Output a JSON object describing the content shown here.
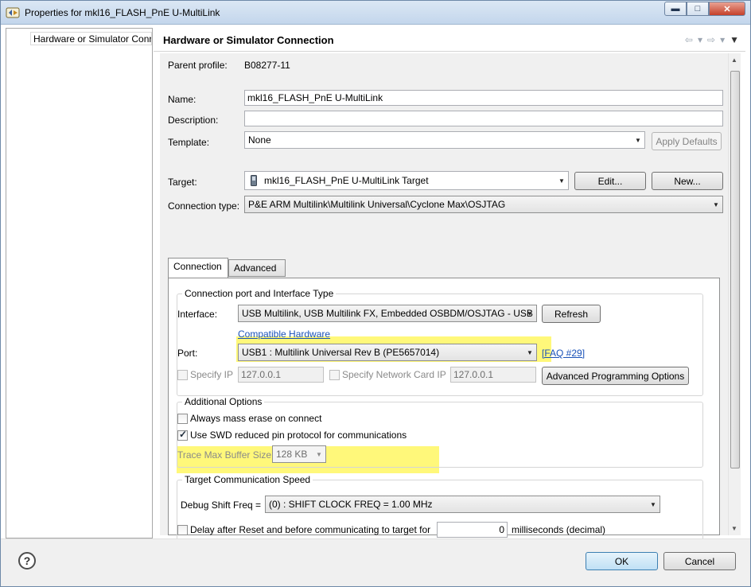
{
  "window": {
    "title": "Properties for mkl16_FLASH_PnE U-MultiLink",
    "minimize": "▬",
    "maximize": "□",
    "close": "✕"
  },
  "sidebar": {
    "items": [
      {
        "label": "Hardware or Simulator Conr"
      }
    ]
  },
  "header": {
    "title": "Hardware or Simulator Connection"
  },
  "form": {
    "parent_profile_label": "Parent profile:",
    "parent_profile_value": "B08277-11",
    "name_label": "Name:",
    "name_value": "mkl16_FLASH_PnE U-MultiLink",
    "description_label": "Description:",
    "description_value": "",
    "template_label": "Template:",
    "template_value": "None",
    "apply_defaults": "Apply Defaults",
    "target_label": "Target:",
    "target_value": "mkl16_FLASH_PnE U-MultiLink Target",
    "edit_button": "Edit...",
    "new_button": "New...",
    "connection_type_label": "Connection type:",
    "connection_type_value": "P&E ARM Multilink\\Multilink Universal\\Cyclone Max\\OSJTAG"
  },
  "tabs": [
    {
      "label": "Connection",
      "active": true
    },
    {
      "label": "Advanced",
      "active": false
    }
  ],
  "connection_port": {
    "group_title": "Connection port and Interface Type",
    "interface_label": "Interface:",
    "interface_value": "USB Multilink, USB Multilink FX, Embedded OSBDM/OSJTAG - USB",
    "refresh_button": "Refresh",
    "compatible_hardware": "Compatible Hardware",
    "port_label": "Port:",
    "port_value": "USB1 : Multilink Universal Rev B (PE5657014)",
    "faq_link": "[FAQ #29]",
    "specify_ip_label": "Specify IP",
    "specify_ip_checked": false,
    "ip_value": "127.0.0.1",
    "specify_network_card_ip_label": "Specify Network Card IP",
    "specify_network_card_ip_checked": false,
    "network_card_ip_value": "127.0.0.1",
    "advanced_programming_options": "Advanced Programming Options"
  },
  "additional_options": {
    "group_title": "Additional Options",
    "mass_erase_label": "Always mass erase on connect",
    "mass_erase_checked": false,
    "swd_label": "Use SWD reduced pin protocol for communications",
    "swd_checked": true,
    "trace_label": "Trace Max Buffer Size:",
    "trace_value": "128 KB"
  },
  "speed": {
    "group_title": "Target Communication Speed",
    "debug_shift_label": "Debug Shift Freq =",
    "debug_shift_value": "(0) : SHIFT CLOCK FREQ = 1.00 MHz",
    "delay_label": "Delay after Reset and before communicating to target for",
    "delay_checked": false,
    "delay_value": "0",
    "delay_units": "milliseconds (decimal)"
  },
  "footer": {
    "help": "?",
    "ok": "OK",
    "cancel": "Cancel"
  },
  "colors": {
    "highlight": "#fff87a",
    "link": "#1a52b8"
  }
}
